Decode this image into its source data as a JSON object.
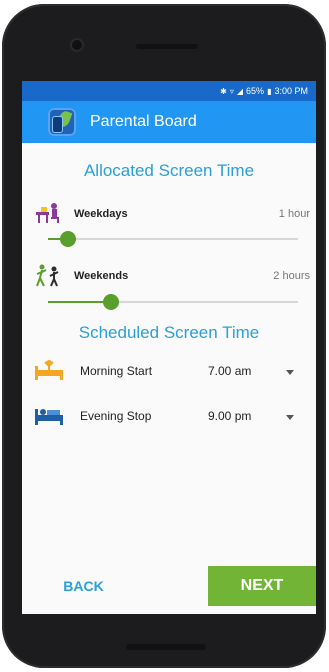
{
  "status_bar": {
    "battery": "65%",
    "time": "3:00 PM",
    "icons": [
      "bluetooth-icon",
      "wifi-icon",
      "signal-icon",
      "battery-icon"
    ]
  },
  "app_bar": {
    "title": "Parental Board",
    "logo_icon": "app-logo-icon"
  },
  "allocated": {
    "title": "Allocated Screen Time",
    "weekdays": {
      "label": "Weekdays",
      "value": "1 hour",
      "slider_fraction": 0.08,
      "icon": "desk-person-icon"
    },
    "weekends": {
      "label": "Weekends",
      "value": "2 hours",
      "slider_fraction": 0.25,
      "icon": "playing-kids-icon"
    }
  },
  "scheduled": {
    "title": "Scheduled Screen Time",
    "morning": {
      "label": "Morning Start",
      "time": "7.00 am",
      "icon": "wake-up-icon"
    },
    "evening": {
      "label": "Evening Stop",
      "time": "9.00 pm",
      "icon": "bed-icon"
    }
  },
  "footer": {
    "back_label": "BACK",
    "next_label": "NEXT"
  },
  "colors": {
    "status_bar": "#1869c9",
    "app_bar": "#2196f3",
    "section_title": "#2a9fd8",
    "slider": "#5a9e2c",
    "next_button": "#72b536"
  }
}
